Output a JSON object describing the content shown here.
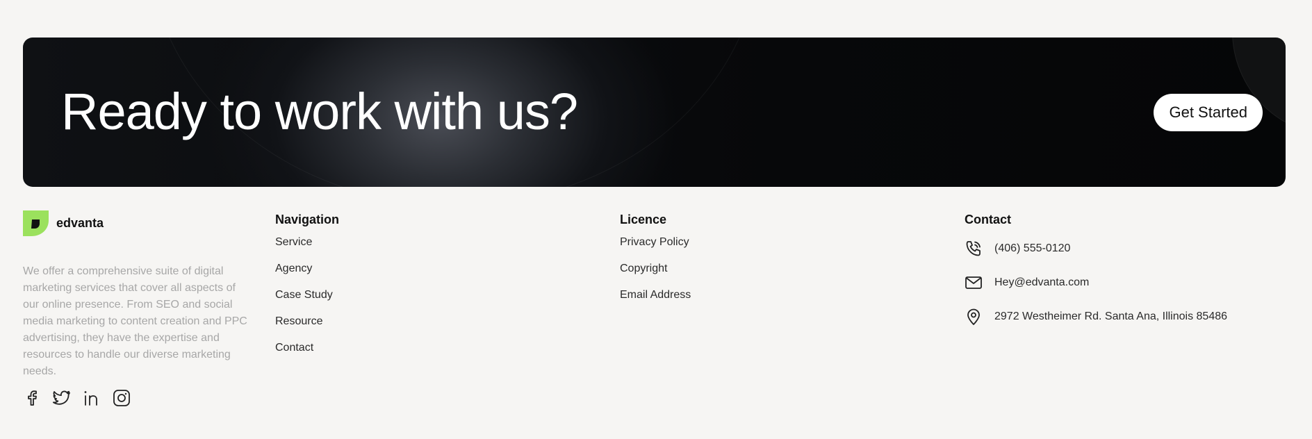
{
  "cta": {
    "title": "Ready to work with us?",
    "button_label": "Get Started"
  },
  "brand": {
    "name": "edvanta",
    "logo_color": "#9be15d",
    "description": "We offer a comprehensive suite of digital marketing services that cover all aspects of our online presence. From SEO and social media marketing to content creation and PPC advertising, they have the expertise and resources to handle our diverse marketing needs.",
    "social_icons": [
      "facebook-icon",
      "twitter-icon",
      "linkedin-icon",
      "instagram-icon"
    ]
  },
  "navigation": {
    "title": "Navigation",
    "links": [
      "Service",
      "Agency",
      "Case Study",
      "Resource",
      "Contact"
    ]
  },
  "licence": {
    "title": "Licence",
    "links": [
      "Privacy Policy",
      "Copyright",
      "Email Address"
    ]
  },
  "contact": {
    "title": "Contact",
    "phone": "(406) 555-0120",
    "email": "Hey@edvanta.com",
    "address": "2972 Westheimer Rd. Santa Ana, Illinois 85486"
  }
}
